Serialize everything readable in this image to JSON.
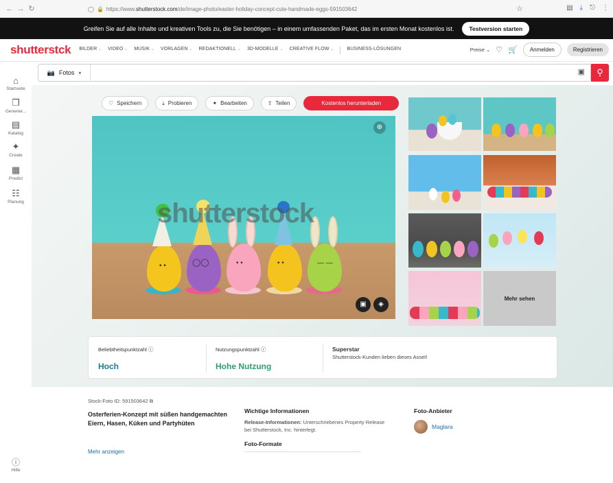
{
  "browser": {
    "url_prefix": "https://www.",
    "url_host": "shutterstock.com",
    "url_path": "/de/image-photo/easter-holiday-concept-cute-handmade-eggs-591503642"
  },
  "promo": {
    "text": "Greifen Sie auf alle Inhalte und kreativen Tools zu, die Sie benötigen – in einem umfassenden Paket, das im ersten Monat kostenlos ist.",
    "cta": "Testversion starten"
  },
  "nav": {
    "logo": "shutterstck",
    "items": [
      "BILDER",
      "VIDEO",
      "MUSIK",
      "VORLAGEN",
      "REDAKTIONELL",
      "3D-MODELLE",
      "CREATIVE FLOW"
    ],
    "business": "BUSINESS-LÖSUNGEN",
    "pricing": "Preise",
    "login": "Anmelden",
    "register": "Registrieren"
  },
  "sidebar": {
    "items": [
      {
        "label": "Startseite",
        "icon": "home-icon"
      },
      {
        "label": "Generier...",
        "icon": "generate-icon"
      },
      {
        "label": "Katalog",
        "icon": "catalog-icon"
      },
      {
        "label": "Create",
        "icon": "create-icon"
      },
      {
        "label": "Predict",
        "icon": "predict-icon"
      },
      {
        "label": "Planung",
        "icon": "planning-icon"
      }
    ],
    "help": "Hilfe"
  },
  "search": {
    "type": "Fotos",
    "placeholder": ""
  },
  "actions": {
    "save": "Speichern",
    "try": "Probieren",
    "edit": "Bearbeiten",
    "share": "Teilen",
    "download": "Kostenlos herunterladen"
  },
  "image": {
    "watermark": "shutterstock"
  },
  "related": {
    "more": "Mehr sehen"
  },
  "stats": {
    "popularity_label": "Beliebtheitspunktzahl",
    "popularity_value": "Hoch",
    "usage_label": "Nutzungspunktzahl",
    "usage_value": "Hohe Nutzung",
    "superstar_label": "Superstar",
    "superstar_text": "Shutterstock-Kunden lieben dieses Asset!"
  },
  "details": {
    "stock_id": "Stock-Foto ID: 591503642",
    "title": "Osterferien-Konzept mit süßen handgemachten Eiern, Hasen, Küken und Partyhüten",
    "more": "Mehr anzeigen",
    "info_heading": "Wichtige Informationen",
    "release_label": "Release-Informationen:",
    "release_text": " Unterschriebenes Property Release bei Shutterstock, Inc. hinterlegt.",
    "formats_heading": "Foto-Formate",
    "provider_heading": "Foto-Anbieter",
    "provider_name": "Maglara"
  },
  "colors": {
    "brand_red": "#e9283b",
    "teal": "#1b7a8f",
    "green": "#2e9e6a"
  }
}
